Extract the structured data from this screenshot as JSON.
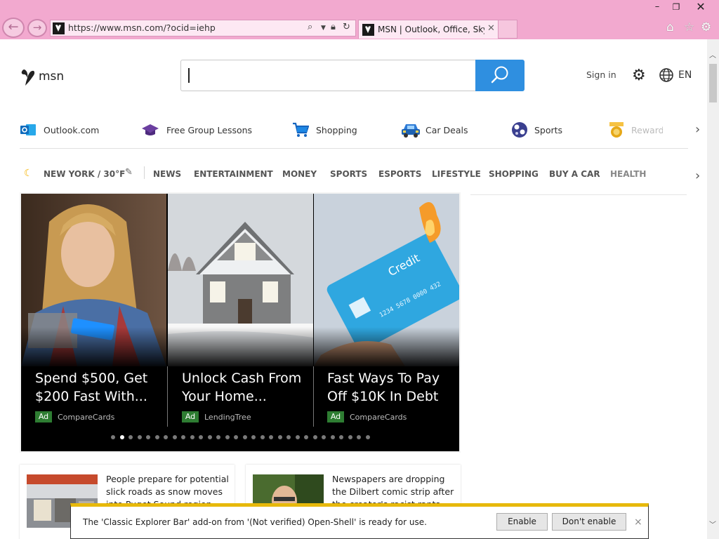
{
  "browser": {
    "url": "https://www.msn.com/?ocid=iehp",
    "tab_title": "MSN | Outlook, Office, Sky...",
    "window_controls": {
      "minimize": "–",
      "maximize": "❐",
      "close": "✕"
    },
    "icons": [
      "back-arrow-icon",
      "forward-arrow-icon",
      "search-icon",
      "lock-icon",
      "refresh-icon",
      "home-icon",
      "favorites-star-icon",
      "tools-gear-icon"
    ]
  },
  "header": {
    "logo_text": "msn",
    "sign_in": "Sign in",
    "language": "EN"
  },
  "quick_links": [
    {
      "label": "Outlook.com",
      "icon": "outlook-icon",
      "color": "#0f6cbd"
    },
    {
      "label": "Free Group Lessons",
      "icon": "graduation-cap-icon",
      "color": "#6b3fa0"
    },
    {
      "label": "Shopping",
      "icon": "shopping-cart-icon",
      "color": "#1565c0"
    },
    {
      "label": "Car Deals",
      "icon": "car-icon",
      "color": "#2e7bd6"
    },
    {
      "label": "Sports",
      "icon": "sports-ball-icon",
      "color": "#3a3f8f"
    },
    {
      "label": "Rewards",
      "icon": "rewards-medal-icon",
      "color": "#e6a817"
    }
  ],
  "category_nav": {
    "weather": "NEW YORK / 30°F",
    "items": [
      "NEWS",
      "ENTERTAINMENT",
      "MONEY",
      "SPORTS",
      "ESPORTS",
      "LIFESTYLE",
      "SHOPPING",
      "BUY A CAR",
      "HEALTH"
    ]
  },
  "carousel": {
    "slides": [
      {
        "headline": "Spend $500, Get $200 Fast With...",
        "ad": "Ad",
        "sponsor": "CompareCards"
      },
      {
        "headline": "Unlock Cash From Your Home...",
        "ad": "Ad",
        "sponsor": "LendingTree"
      },
      {
        "headline": "Fast Ways To Pay Off $10K In Debt",
        "ad": "Ad",
        "sponsor": "CompareCards"
      }
    ],
    "dot_count": 30,
    "active_dot": 1
  },
  "card_text": {
    "credit_word": "Credit",
    "card_number": "1234 5678 0000 432"
  },
  "stories": [
    {
      "title": "People prepare for potential slick roads as snow moves into Puget Sound region"
    },
    {
      "title": "Newspapers are dropping the Dilbert comic strip after the creator's racist rants"
    }
  ],
  "notification": {
    "message": "The 'Classic Explorer Bar' add-on from '(Not verified) Open-Shell' is ready for use.",
    "enable": "Enable",
    "dont_enable": "Don't enable",
    "close": "×"
  },
  "colors": {
    "chrome": "#f2a9cf",
    "search_button": "#2f8fe0",
    "ad_badge": "#2e7d32",
    "notification_accent": "#e7b90b"
  }
}
